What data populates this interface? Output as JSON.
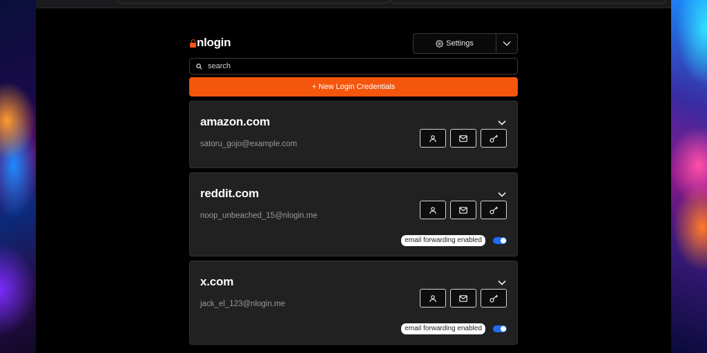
{
  "app": {
    "logo_text": "nlogin",
    "settings_label": "Settings",
    "search_placeholder": "search",
    "new_button_label": "+ New Login Credentials",
    "accent": "#f4560d"
  },
  "credentials": [
    {
      "domain": "amazon.com",
      "username": "satoru_gojo@example.com",
      "forwarding": null
    },
    {
      "domain": "reddit.com",
      "username": "noop_unbeached_15@nlogin.me",
      "forwarding": "email forwarding enabled"
    },
    {
      "domain": "x.com",
      "username": "jack_el_123@nlogin.me",
      "forwarding": "email forwarding enabled"
    }
  ],
  "icons": {
    "copy_user": "user-icon",
    "copy_email": "mail-icon",
    "copy_password": "key-icon",
    "expand": "chevron-down-icon",
    "settings": "gear-icon",
    "search": "search-icon"
  }
}
